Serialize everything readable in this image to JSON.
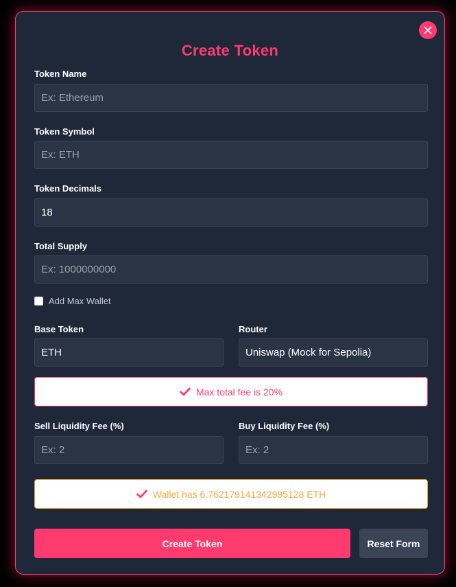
{
  "modal": {
    "title": "Create Token",
    "close_icon": "close-icon"
  },
  "fields": {
    "token_name": {
      "label": "Token Name",
      "placeholder": "Ex: Ethereum",
      "value": ""
    },
    "token_symbol": {
      "label": "Token Symbol",
      "placeholder": "Ex: ETH",
      "value": ""
    },
    "token_decimals": {
      "label": "Token Decimals",
      "placeholder": "",
      "value": "18"
    },
    "total_supply": {
      "label": "Total Supply",
      "placeholder": "Ex: 1000000000",
      "value": ""
    },
    "base_token": {
      "label": "Base Token",
      "value": "ETH"
    },
    "router": {
      "label": "Router",
      "value": "Uniswap (Mock for Sepolia)"
    },
    "sell_liquidity_fee": {
      "label": "Sell Liquidity Fee (%)",
      "placeholder": "Ex: 2",
      "value": ""
    },
    "buy_liquidity_fee": {
      "label": "Buy Liquidity Fee (%)",
      "placeholder": "Ex: 2",
      "value": ""
    }
  },
  "max_wallet": {
    "label": "Add Max Wallet",
    "checked": false
  },
  "notices": {
    "fee": {
      "text": "Max total fee is 20%",
      "icon": "check-icon",
      "color": "#ff3a6e"
    },
    "wallet": {
      "text": "Wallet has 6.762179141342995128 ETH",
      "icon": "check-icon",
      "color": "#f0a93c"
    }
  },
  "actions": {
    "create_label": "Create Token",
    "reset_label": "Reset Form"
  },
  "colors": {
    "accent": "#ff3a6e",
    "warning": "#f0a93c",
    "panel": "#1e2839",
    "input_bg": "#2b3444"
  }
}
